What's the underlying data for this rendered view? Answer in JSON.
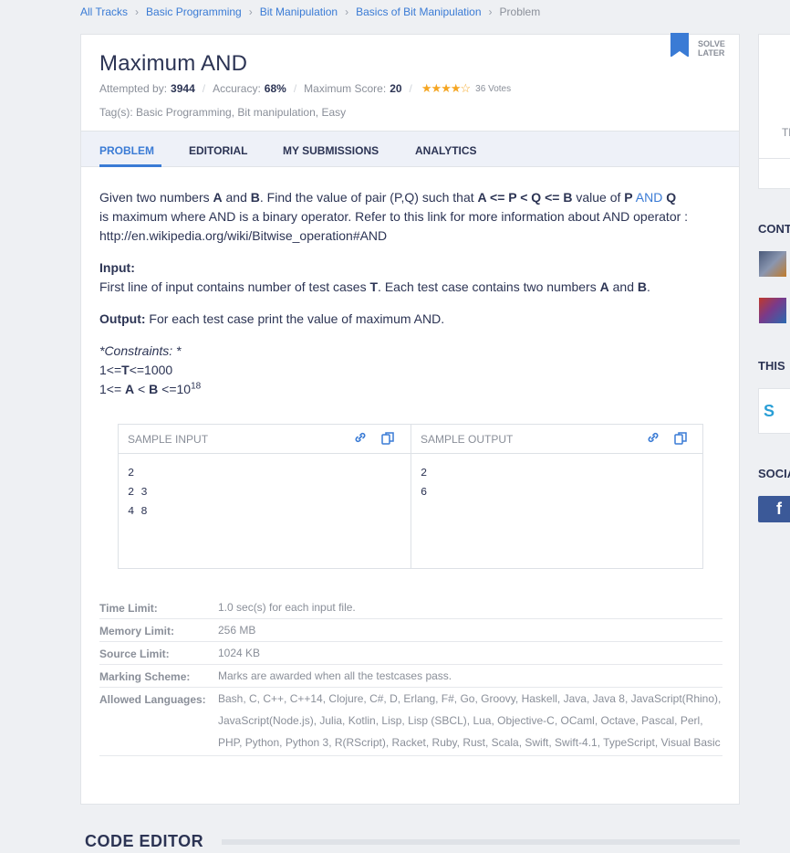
{
  "breadcrumb": [
    "All Tracks",
    "Basic Programming",
    "Bit Manipulation",
    "Basics of Bit Manipulation",
    "Problem"
  ],
  "problem": {
    "title": "Maximum AND",
    "attempted_label": "Attempted by:",
    "attempted": "3944",
    "accuracy_label": "Accuracy:",
    "accuracy": "68%",
    "max_score_label": "Maximum Score:",
    "max_score": "20",
    "rating": 4,
    "votes": "36",
    "votes_label": "Votes",
    "tags_label": "Tag(s):",
    "tags": "Basic Programming, Bit manipulation, Easy",
    "solve_later": [
      "SOLVE",
      "LATER"
    ]
  },
  "tabs": [
    "PROBLEM",
    "EDITORIAL",
    "MY SUBMISSIONS",
    "ANALYTICS"
  ],
  "statement": {
    "p1_a": "Given two numbers ",
    "p1_A": "A",
    "p1_and": " and ",
    "p1_B": "B",
    "p1_b": ". Find the value of pair (P,Q) such that ",
    "p1_cond": "A <= P < Q <= B",
    "p1_c": " value of ",
    "p1_P": "P",
    "p1_sp": " ",
    "p1_AND": "AND",
    "p1_Q": "Q",
    "p1_d": "is maximum where AND is a binary operator. Refer to this link for more information about AND operator : http://en.wikipedia.org/wiki/Bitwise_operation#AND",
    "input_label": "Input:",
    "input_a": "First line of input contains number of test cases ",
    "input_T": "T",
    "input_b": ". Each test case contains two numbers ",
    "input_A": "A",
    "input_and": " and ",
    "input_B": "B",
    "input_dot": ".",
    "output_label": "Output:",
    "output_text": " For each test case print the value of maximum AND.",
    "constraints_label": "*Constraints: *",
    "c1_a": "1<=",
    "c1_T": "T",
    "c1_b": "<=1000",
    "c2_a": "1<= ",
    "c2_A": "A",
    "c2_lt": " < ",
    "c2_B": "B",
    "c2_b": " <=10",
    "c2_exp": "18"
  },
  "sample": {
    "input_label": "SAMPLE INPUT",
    "output_label": "SAMPLE OUTPUT",
    "input": "2\n2 3\n4 8",
    "output": "2\n6"
  },
  "info": [
    {
      "key": "Time Limit:",
      "value": "1.0 sec(s) for each input file."
    },
    {
      "key": "Memory Limit:",
      "value": "256 MB"
    },
    {
      "key": "Source Limit:",
      "value": "1024 KB"
    },
    {
      "key": "Marking Scheme:",
      "value": "Marks are awarded when all the testcases pass."
    },
    {
      "key": "Allowed Languages:",
      "value": "Bash, C, C++, C++14, Clojure, C#, D, Erlang, F#, Go, Groovy, Haskell, Java, Java 8, JavaScript(Rhino), JavaScript(Node.js), Julia, Kotlin, Lisp, Lisp (SBCL), Lua, Objective-C, OCaml, Octave, Pascal, Perl, PHP, Python, Python 3, R(RScript), Racket, Ruby, Rust, Scala, Swift, Swift-4.1, TypeScript, Visual Basic"
    }
  ],
  "code_editor_label": "CODE EDITOR",
  "sidebar": {
    "th": "Th",
    "cont": "CONT",
    "this": "THIS",
    "soci": "SOCIA",
    "sponsor_logo": "S"
  },
  "colors": {
    "accent": "#3a7bd5",
    "star": "#f5a623",
    "facebook": "#3b5998"
  }
}
